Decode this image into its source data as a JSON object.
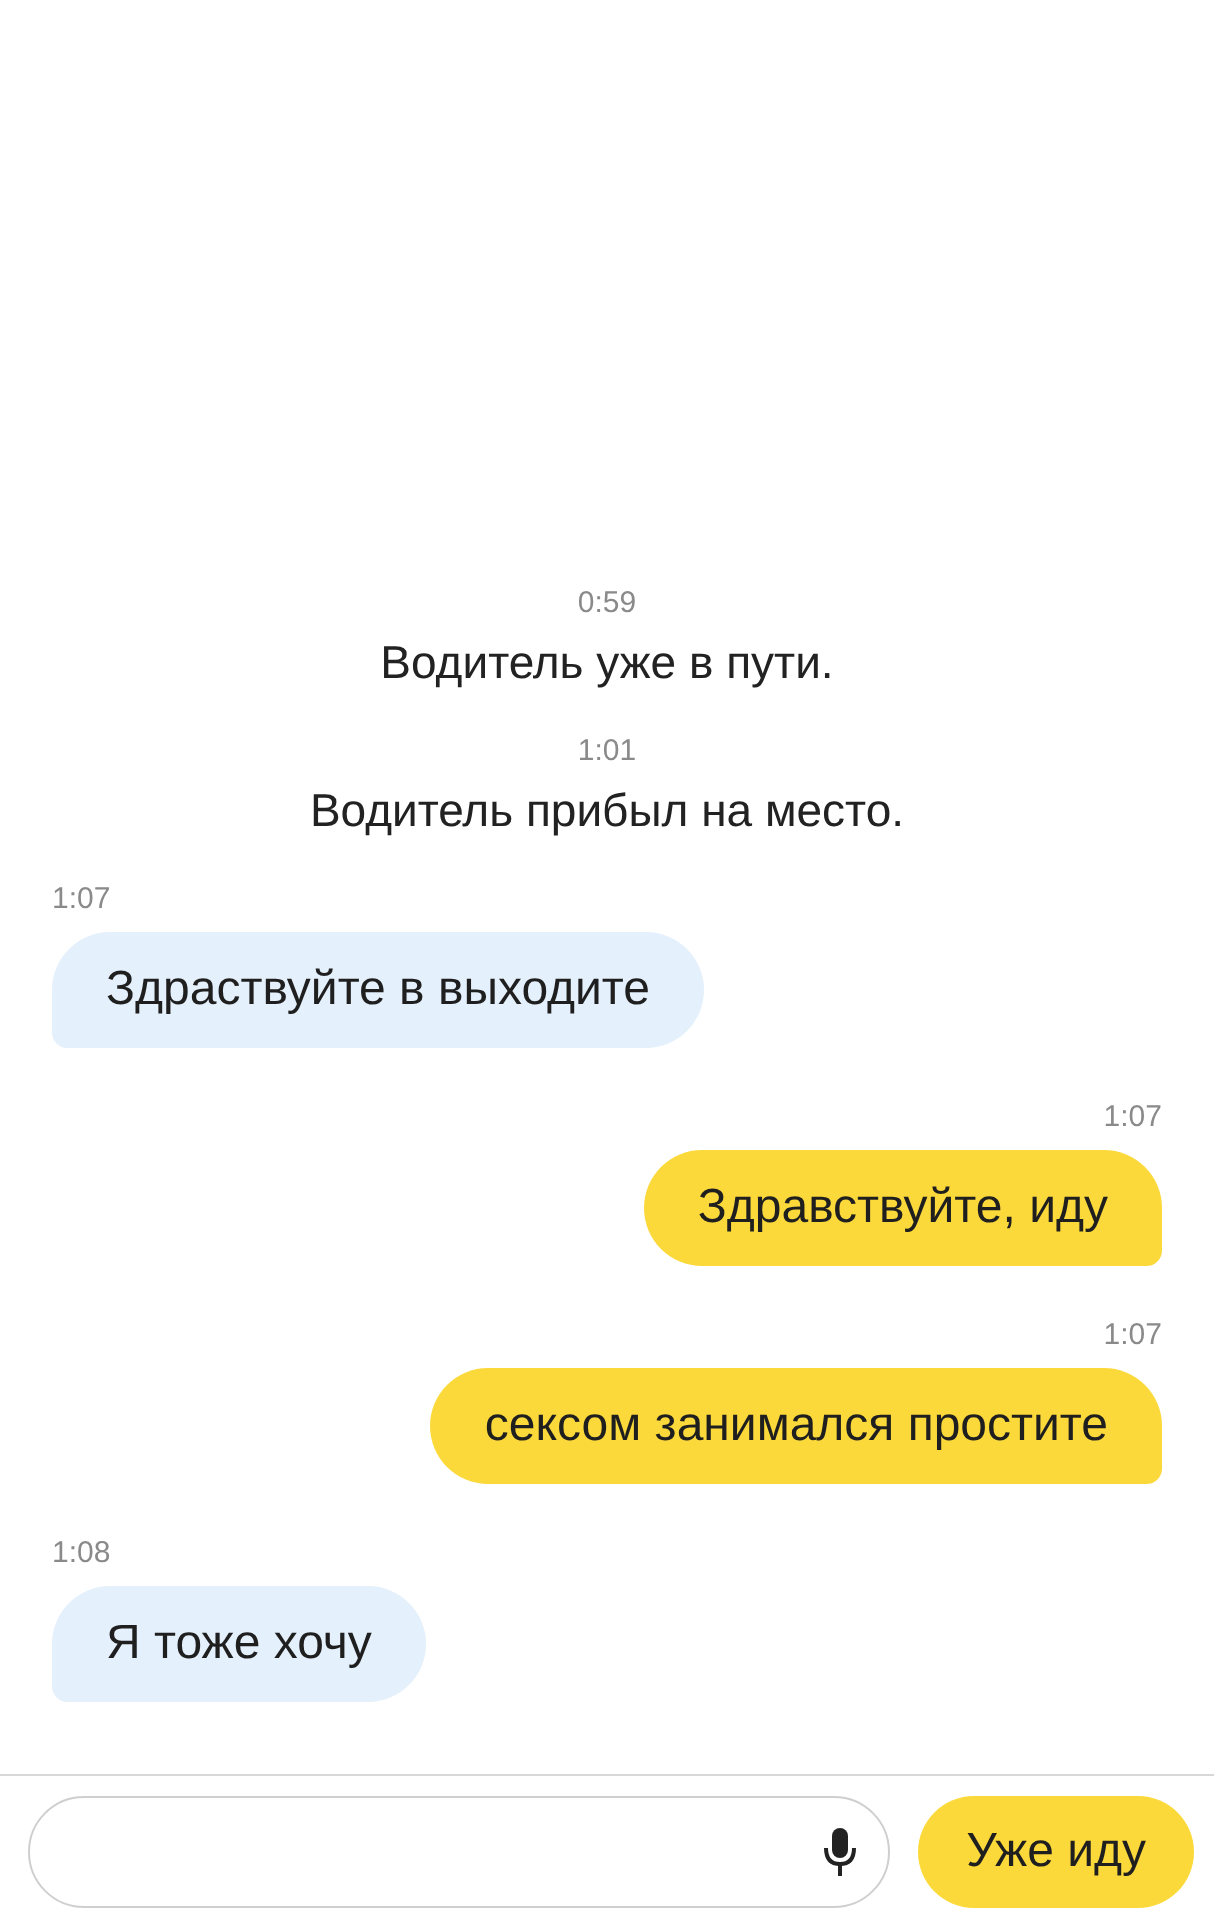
{
  "messages": [
    {
      "kind": "system",
      "time": "0:59",
      "text": "Водитель уже в пути."
    },
    {
      "kind": "system",
      "time": "1:01",
      "text": "Водитель прибыл на место."
    },
    {
      "kind": "incoming",
      "time": "1:07",
      "text": "Здраствуйте в выходите"
    },
    {
      "kind": "outgoing",
      "time": "1:07",
      "text": "Здравствуйте, иду"
    },
    {
      "kind": "outgoing",
      "time": "1:07",
      "text": "сексом занимался простите"
    },
    {
      "kind": "incoming",
      "time": "1:08",
      "text": "Я тоже хочу"
    }
  ],
  "composer": {
    "quick_reply": "Уже иду"
  }
}
